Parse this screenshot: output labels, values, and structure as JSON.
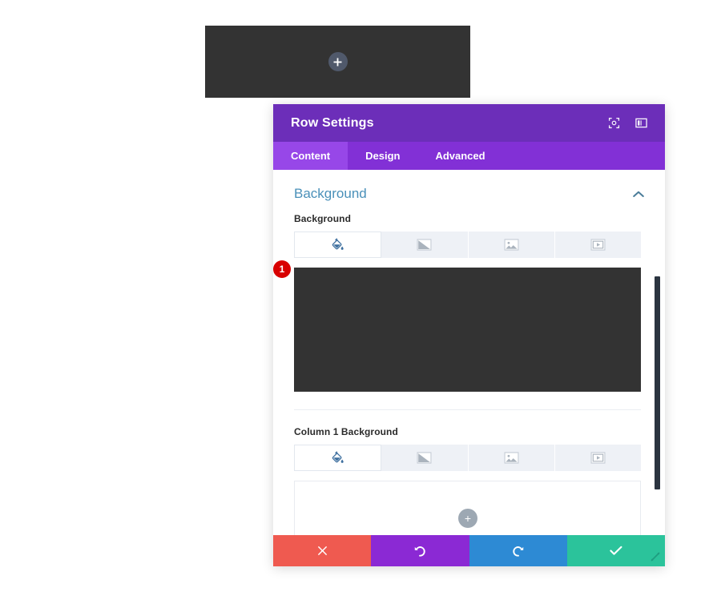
{
  "preview": {
    "add_label": "+",
    "add_icon": "plus-icon",
    "bg_color": "#333333"
  },
  "modal": {
    "title": "Row Settings",
    "header": {
      "icons": [
        {
          "name": "focus-target-icon",
          "label": ""
        },
        {
          "name": "layout-panel-icon",
          "label": ""
        }
      ],
      "bg_color": "#6c2eb9"
    },
    "tabs": [
      {
        "label": "Content",
        "active": true
      },
      {
        "label": "Design",
        "active": false
      },
      {
        "label": "Advanced",
        "active": false
      }
    ],
    "sections": [
      {
        "title": "Background",
        "collapsed": false,
        "chevron": "chevron-up-icon"
      }
    ],
    "fields": [
      {
        "label": "Background",
        "options": [
          {
            "icon": "paint-bucket-icon",
            "active": true
          },
          {
            "icon": "gradient-icon",
            "active": false
          },
          {
            "icon": "image-icon",
            "active": false
          },
          {
            "icon": "video-icon",
            "active": false
          }
        ],
        "badge": "1",
        "preview_color": "#333333"
      },
      {
        "label": "Column 1 Background",
        "options": [
          {
            "icon": "paint-bucket-icon",
            "active": true
          },
          {
            "icon": "gradient-icon",
            "active": false
          },
          {
            "icon": "image-icon",
            "active": false
          },
          {
            "icon": "video-icon",
            "active": false
          }
        ],
        "preview_color": "#ffffff"
      }
    ],
    "float_add_label": "+",
    "footer": {
      "buttons": [
        {
          "name": "cancel-button",
          "icon": "close-icon",
          "color": "#ef5a50"
        },
        {
          "name": "undo-button",
          "icon": "undo-icon",
          "color": "#8b29d4"
        },
        {
          "name": "redo-button",
          "icon": "redo-icon",
          "color": "#2d8ad4"
        },
        {
          "name": "save-button",
          "icon": "check-icon",
          "color": "#2bc39b"
        }
      ],
      "resize_icon": "resize-handle-icon"
    },
    "colors": {
      "header": "#6c2eb9",
      "tabbar": "#8230d6",
      "tab_active": "#9747e8",
      "section_title": "#4a90b9",
      "badge": "#d80000",
      "scrollbar": "#2b3440"
    }
  }
}
